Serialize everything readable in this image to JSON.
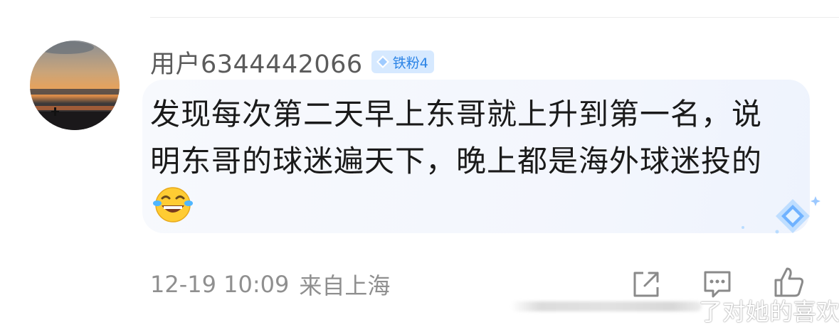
{
  "comment": {
    "username": "用户6344442066",
    "fan_badge": {
      "label": "铁粉4",
      "icon": "diamond-icon",
      "color": "#2a83e6",
      "background": "#d6e9ff"
    },
    "text_lines": [
      "发现每次第二天早上东哥就上升到第一名，说",
      "明东哥的球迷遍天下，晚上都是海外球迷投的"
    ],
    "emoji": "grinning-tears-emoji",
    "timestamp": "12-19 10:09",
    "location": "来自上海",
    "actions": [
      {
        "name": "share",
        "icon": "share-icon"
      },
      {
        "name": "comment",
        "icon": "comment-icon"
      },
      {
        "name": "like",
        "icon": "thumbs-up-icon"
      }
    ]
  },
  "watermark": {
    "text": "了对她的喜欢"
  },
  "colors": {
    "username": "#5b5b5b",
    "body_text": "#1a1a1a",
    "meta_text": "#8f8f8f",
    "bubble_bg": "#f4f7fd"
  }
}
